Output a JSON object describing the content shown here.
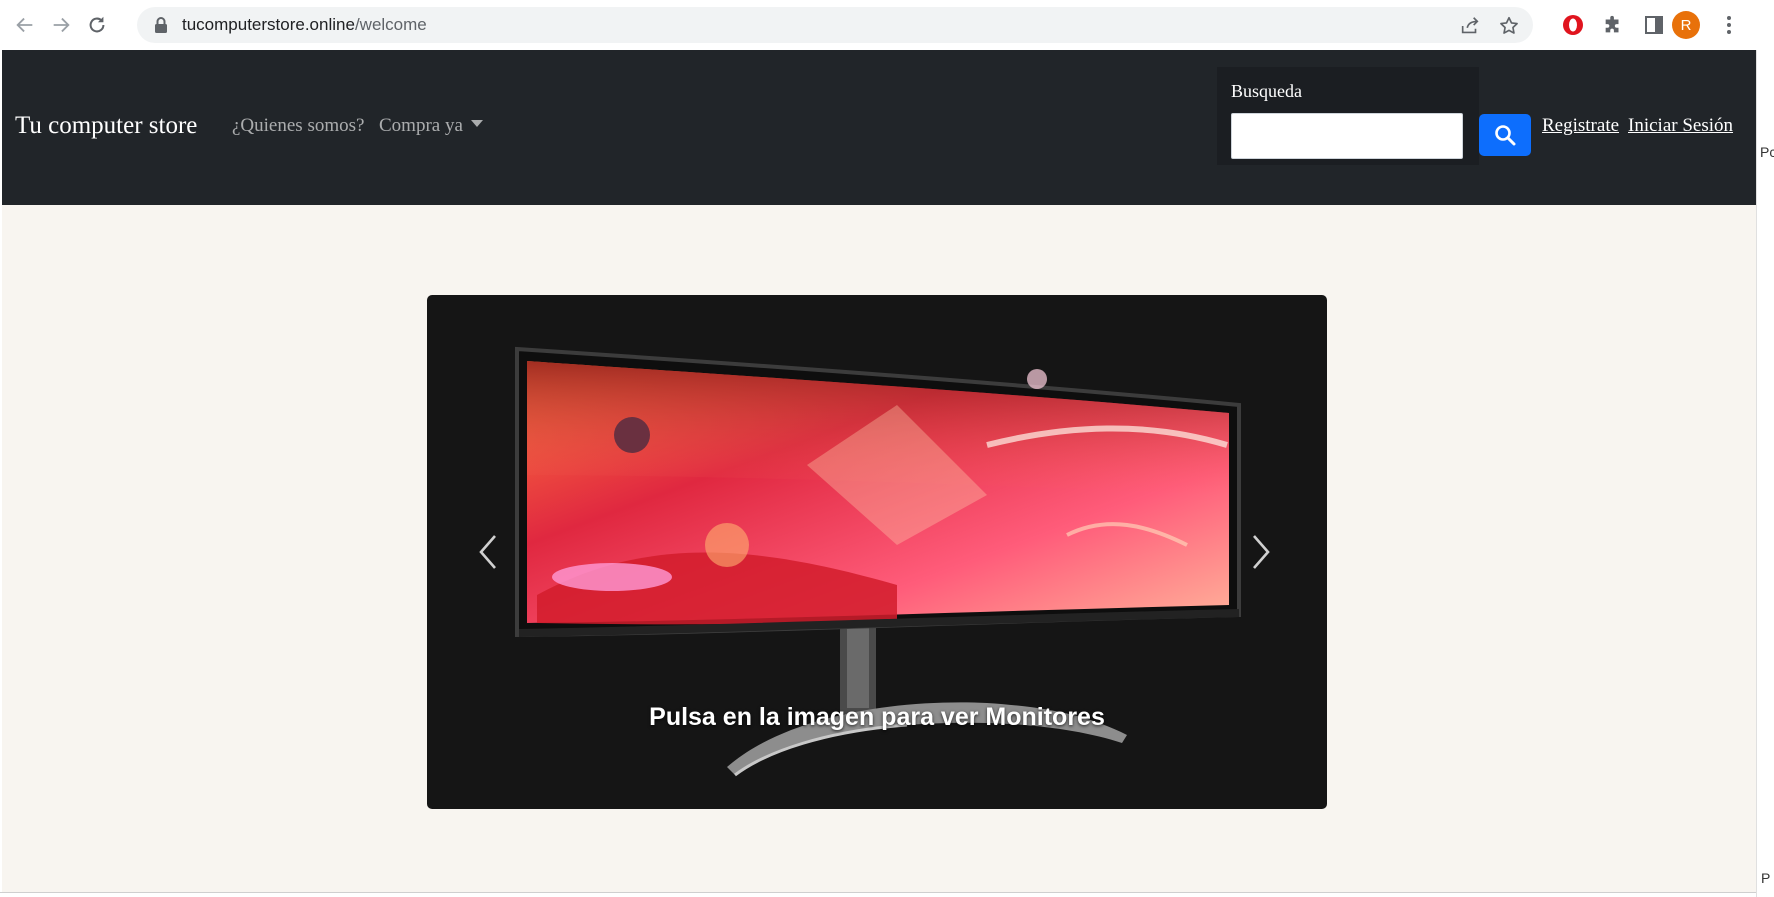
{
  "browser": {
    "url_host": "tucomputerstore.online",
    "url_path": "/welcome",
    "profile_initial": "R",
    "icons": [
      "back-arrow-icon",
      "forward-arrow-icon",
      "reload-icon",
      "lock-icon",
      "share-icon",
      "star-icon",
      "opera-extension-icon",
      "puzzle-extensions-icon",
      "side-panel-icon",
      "kebab-menu-icon"
    ]
  },
  "navbar": {
    "brand": "Tu computer store",
    "links": [
      {
        "label": "¿Quienes somos?"
      },
      {
        "label": "Compra ya",
        "dropdown": true
      }
    ],
    "search": {
      "label": "Busqueda",
      "value": "",
      "placeholder": ""
    },
    "auth": {
      "register": "Registrate",
      "login": "Iniciar Sesión"
    }
  },
  "carousel": {
    "caption": "Pulsa en la imagen para ver Monitores",
    "slide_subject": "curved-gaming-monitor"
  },
  "edge_fragments": {
    "top": "Pc",
    "bottom": "P"
  },
  "colors": {
    "navbar_bg": "#212529",
    "page_bg": "#f8f5f0",
    "search_button": "#0d6efd",
    "carousel_bg": "#151515",
    "profile_avatar": "#e8710a",
    "opera_red": "#e0141e"
  }
}
